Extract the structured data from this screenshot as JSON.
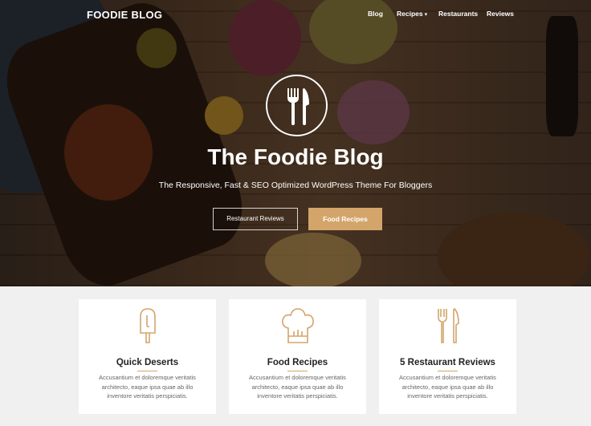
{
  "brand": "FOODIE BLOG",
  "nav": {
    "items": [
      {
        "label": "Blog"
      },
      {
        "label": "Recipes"
      },
      {
        "label": "Restaurants"
      },
      {
        "label": "Reviews"
      }
    ]
  },
  "hero": {
    "title": "The Foodie Blog",
    "subtitle": "The Responsive, Fast & SEO Optimized WordPress Theme For Bloggers",
    "button_outline": "Restaurant Reviews",
    "button_solid": "Food Recipes"
  },
  "cards": [
    {
      "icon": "popsicle-icon",
      "title": "Quick Deserts",
      "text": "Accusantium et doloremque veritatis architecto, eaque ipsa quae ab illo inventore veritatis perspiciatis."
    },
    {
      "icon": "chef-hat-icon",
      "title": "Food Recipes",
      "text": "Accusantium et doloremque veritatis architecto, eaque ipsa quae ab illo inventore veritatis perspiciatis."
    },
    {
      "icon": "fork-knife-icon",
      "title": "5 Restaurant Reviews",
      "text": "Accusantium et doloremque veritatis architecto, eaque ipsa quae ab illo inventore veritatis perspiciatis."
    }
  ],
  "colors": {
    "accent": "#d3a56a",
    "card_bg": "#ffffff",
    "page_bg": "#f0f0f0"
  }
}
